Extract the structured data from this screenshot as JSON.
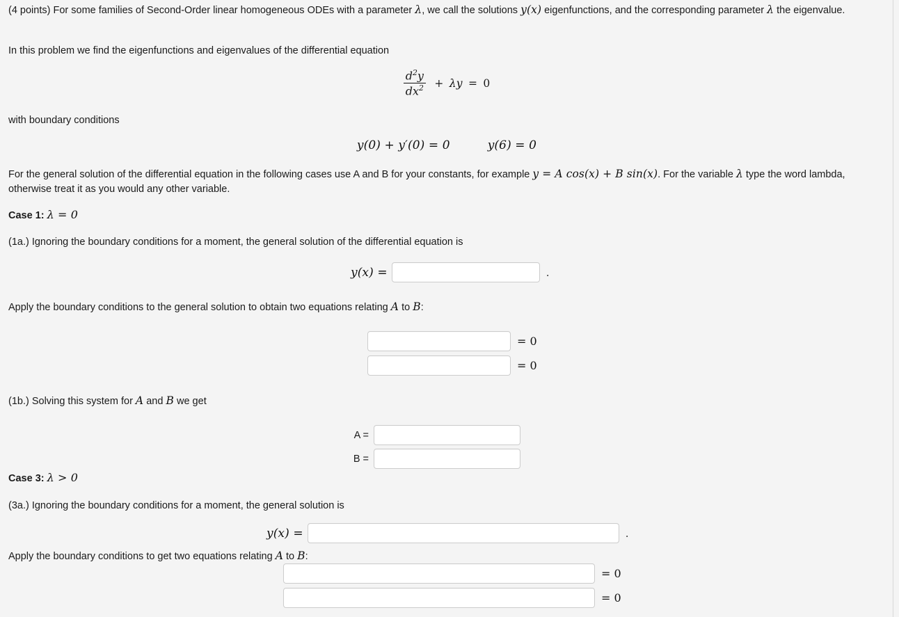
{
  "problem": {
    "intro_prefix": "(4 points) For some families of Second-Order linear homogeneous ODEs with a parameter ",
    "intro_lambda": "λ",
    "intro_mid": ", we call the solutions ",
    "intro_yx": "y(x)",
    "intro_mid2": " eigenfunctions, and the corresponding parameter ",
    "intro_lambda2": "λ",
    "intro_end": " the eigenvalue.",
    "line2": "In this problem we find the eigenfunctions and eigenvalues of the differential equation",
    "equation": {
      "num_d": "d",
      "num_exp": "2",
      "num_y": "y",
      "den_d": "d",
      "den_x": "x",
      "den_exp": "2",
      "rest_plus": "+",
      "rest_lambda": "λ",
      "rest_y": "y",
      "rest_eq": "=",
      "rest_zero": "0"
    },
    "bc_label": "with boundary conditions",
    "bc_first": "y(0) + y′(0) = 0",
    "bc_second": "y(6) = 0",
    "instructions_a": "For the general solution of the differential equation in the following cases use A and B for your constants, for example ",
    "instructions_example": "y = A cos(x) + B sin(x)",
    "instructions_b": ". For the variable ",
    "instructions_lambda": "λ",
    "instructions_c": " type the word lambda, otherwise treat it as you would any other variable."
  },
  "case1": {
    "heading_label": "Case 1:",
    "heading_math": "λ = 0",
    "q1a": "(1a.) Ignoring the boundary conditions for a moment, the general solution of the differential equation is",
    "yx_label": "y(x) =",
    "yx_value": "",
    "yx_placeholder": "",
    "trailing_dot": ".",
    "apply_bc_a": "Apply the boundary conditions to the general solution to obtain two equations relating ",
    "apply_bc_A": "A",
    "apply_bc_mid": " to ",
    "apply_bc_B": "B",
    "apply_bc_end": ":",
    "eq1_value": "",
    "eq1_rhs": "= 0",
    "eq2_value": "",
    "eq2_rhs": "= 0",
    "q1b_a": "(1b.) Solving this system for ",
    "q1b_A": "A",
    "q1b_mid": " and ",
    "q1b_B": "B",
    "q1b_end": " we get",
    "a_label": "A =",
    "a_value": "",
    "b_label": "B =",
    "b_value": ""
  },
  "case3": {
    "heading_label": "Case 3:",
    "heading_math": "λ > 0",
    "q3a": "(3a.) Ignoring the boundary conditions for a moment, the general solution is",
    "yx_label": "y(x) =",
    "yx_value": "",
    "trailing_dot": ".",
    "apply_bc_a": "Apply the boundary conditions to get two equations relating ",
    "apply_bc_A": "A",
    "apply_bc_mid": " to ",
    "apply_bc_B": "B",
    "apply_bc_end": ":",
    "eq1_value": "",
    "eq1_rhs": "= 0",
    "eq2_value": "",
    "eq2_rhs": "= 0"
  },
  "colors": {
    "background": "#f4f4f4",
    "input_background": "#ffffff",
    "input_border": "#cccccc",
    "text": "#1a1a1a"
  }
}
